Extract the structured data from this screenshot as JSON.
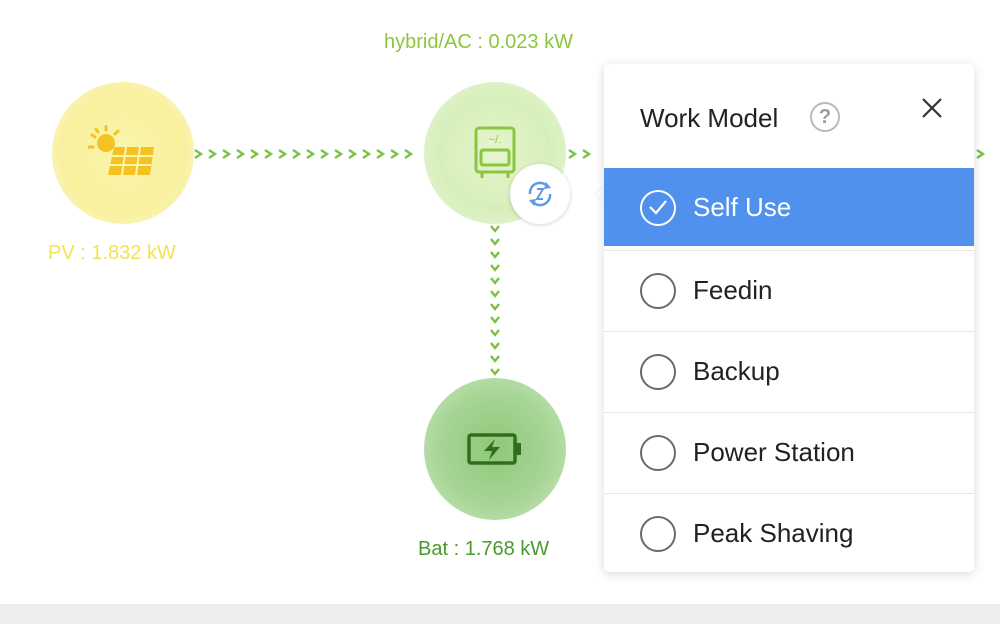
{
  "labels": {
    "inverter": "hybrid/AC : 0.023 kW",
    "pv": "PV : 1.832 kW",
    "battery": "Bat : 1.768 kW"
  },
  "icons": {
    "pv": "solar-panel-icon",
    "inverter": "inverter-icon",
    "battery": "battery-charging-icon",
    "switch": "switch-mode-icon",
    "help": "help-icon",
    "close": "close-icon",
    "check": "check-icon"
  },
  "popover": {
    "title": "Work Model",
    "help_glyph": "?",
    "options": [
      {
        "label": "Self Use",
        "selected": true
      },
      {
        "label": "Feedin",
        "selected": false
      },
      {
        "label": "Backup",
        "selected": false
      },
      {
        "label": "Power Station",
        "selected": false
      },
      {
        "label": "Peak Shaving",
        "selected": false
      }
    ]
  },
  "colors": {
    "selected_bg": "#4f91ed",
    "pv_label": "#f2e34f",
    "inverter_label": "#8cc63f",
    "battery_label": "#4a9a2c",
    "flow": "#7cc242"
  }
}
